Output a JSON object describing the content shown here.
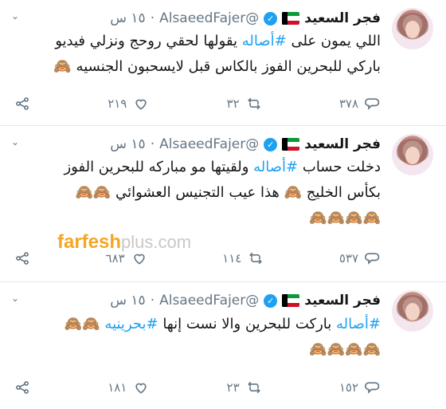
{
  "tweets": [
    {
      "name": "فجر السعيد",
      "handle": "@AlsaeedFajer",
      "dot": "·",
      "time": "١٥ س",
      "lines": [
        {
          "before": "اللي يمون على ",
          "hashtag": "#أصاله",
          "after": " يقولها لحقي روحج ونزلي فيديو"
        },
        {
          "before": "باركي للبحرين الفوز بالكاس قبل لايسحبون الجنسيه 🙈",
          "hashtag": "",
          "after": ""
        }
      ],
      "actions": {
        "replies": "٣٧٨",
        "retweets": "٣٢",
        "likes": "٢١٩"
      }
    },
    {
      "name": "فجر السعيد",
      "handle": "@AlsaeedFajer",
      "dot": "·",
      "time": "١٥ س",
      "lines": [
        {
          "before": "دخلت حساب ",
          "hashtag": "#أصاله",
          "after": " ولقيتها مو مباركه للبحرين الفوز"
        },
        {
          "before": "بكأس الخليج 🙈 هذا عيب التجنيس العشوائي 🙈🙈",
          "hashtag": "",
          "after": ""
        },
        {
          "before": "🙈🙈🙈🙈",
          "hashtag": "",
          "after": ""
        }
      ],
      "actions": {
        "replies": "٥٣٧",
        "retweets": "١١٤",
        "likes": "٦٨٣"
      }
    },
    {
      "name": "فجر السعيد",
      "handle": "@AlsaeedFajer",
      "dot": "·",
      "time": "١٥ س",
      "lines": [
        {
          "before": "",
          "hashtag": "#أصاله",
          "after": " باركت للبحرين والا نست إنها "
        },
        {
          "before": "🙈🙈🙈🙈",
          "hashtag": "",
          "after": ""
        }
      ],
      "hashtag2": "#بحرينيه",
      "emoji_tail": " 🙈🙈",
      "actions": {
        "replies": "١٥٢",
        "retweets": "٢٣",
        "likes": "١٨١"
      }
    }
  ],
  "watermark": {
    "brand": "farfesh",
    "suffix": "plus.com"
  },
  "icons": [
    "verified-badge-icon",
    "kuwait-flag-icon",
    "chevron-down-icon",
    "reply-icon",
    "retweet-icon",
    "like-icon",
    "share-icon"
  ],
  "colors": {
    "link": "#1da1f2",
    "muted": "#657786",
    "text": "#14171a",
    "border": "#e1e8ed"
  }
}
